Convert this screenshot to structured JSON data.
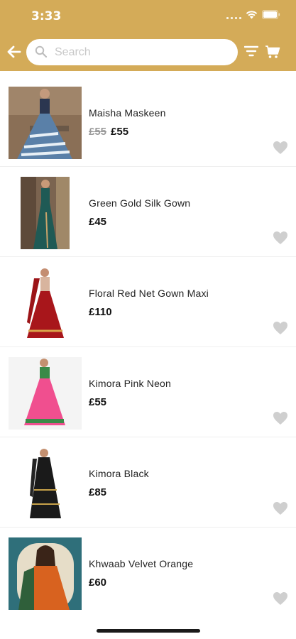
{
  "status_bar": {
    "time": "3:33"
  },
  "search": {
    "placeholder": "Search",
    "value": ""
  },
  "products": [
    {
      "name": "Maisha Maskeen",
      "old_price": "£55",
      "price": "£55",
      "thumb_colors": [
        "#8a7055",
        "#5a7fa8",
        "#e6eef5"
      ]
    },
    {
      "name": "Green Gold Silk Gown",
      "old_price": "",
      "price": "£45",
      "thumb_colors": [
        "#6d5a45",
        "#1f5a55",
        "#b89a6a"
      ]
    },
    {
      "name": "Floral Red Net Gown Maxi",
      "old_price": "",
      "price": "£110",
      "thumb_colors": [
        "#ffffff",
        "#a8161b",
        "#d9b7a0"
      ]
    },
    {
      "name": "Kimora Pink Neon",
      "old_price": "",
      "price": "£55",
      "thumb_colors": [
        "#f4f4f4",
        "#f04f8f",
        "#3b8a48"
      ]
    },
    {
      "name": "Kimora Black",
      "old_price": "",
      "price": "£85",
      "thumb_colors": [
        "#ffffff",
        "#1a1a1a",
        "#c7a24a"
      ]
    },
    {
      "name": "Khwaab Velvet Orange",
      "old_price": "",
      "price": "£60",
      "thumb_colors": [
        "#2f6f7a",
        "#d8621f",
        "#2f5f3a"
      ]
    }
  ],
  "colors": {
    "brand": "#d4ab58",
    "heart": "#cfcfcf"
  }
}
